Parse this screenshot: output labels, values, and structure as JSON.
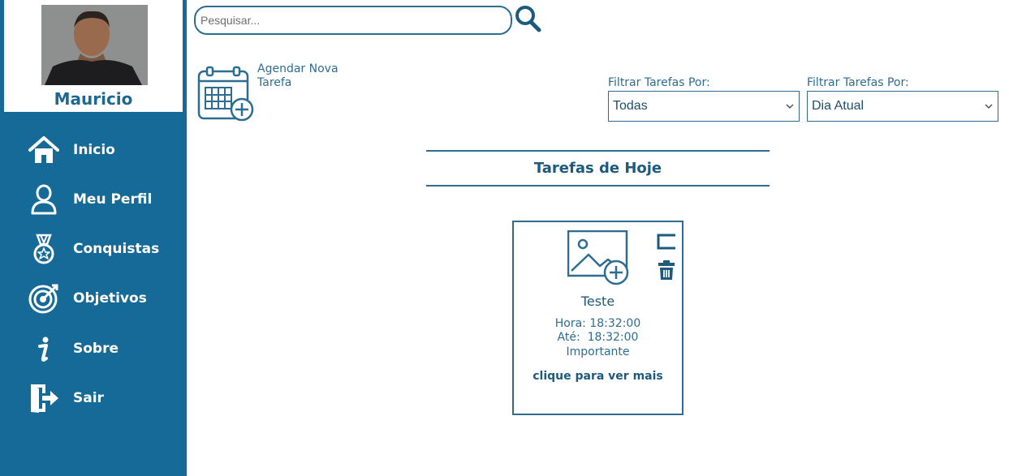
{
  "user": {
    "name": "Mauricio"
  },
  "nav": {
    "items": [
      {
        "label": "Inicio",
        "icon": "home-icon"
      },
      {
        "label": "Meu Perfil",
        "icon": "user-icon"
      },
      {
        "label": "Conquistas",
        "icon": "medal-icon"
      },
      {
        "label": "Objetivos",
        "icon": "target-icon"
      },
      {
        "label": "Sobre",
        "icon": "info-icon"
      },
      {
        "label": "Sair",
        "icon": "exit-icon"
      }
    ]
  },
  "search": {
    "placeholder": "Pesquisar...",
    "value": "",
    "icon": "search-icon"
  },
  "new_task": {
    "label": "Agendar Nova Tarefa",
    "icon": "calendar-add-icon"
  },
  "filters": [
    {
      "label": "Filtrar Tarefas Por:",
      "selected": "Todas"
    },
    {
      "label": "Filtrar Tarefas Por:",
      "selected": "Dia Atual"
    }
  ],
  "section": {
    "title": "Tarefas de Hoje"
  },
  "tasks": [
    {
      "title": "Teste",
      "hora": "Hora: 18:32:00",
      "ate": "Até:  18:32:00",
      "priority": "Importante",
      "more": "clique para ver mais",
      "icon": "image-add-icon"
    }
  ],
  "colors": {
    "sidebar": "#156a98",
    "accent": "#2c6d91",
    "text_dark": "#1d5a7e"
  }
}
